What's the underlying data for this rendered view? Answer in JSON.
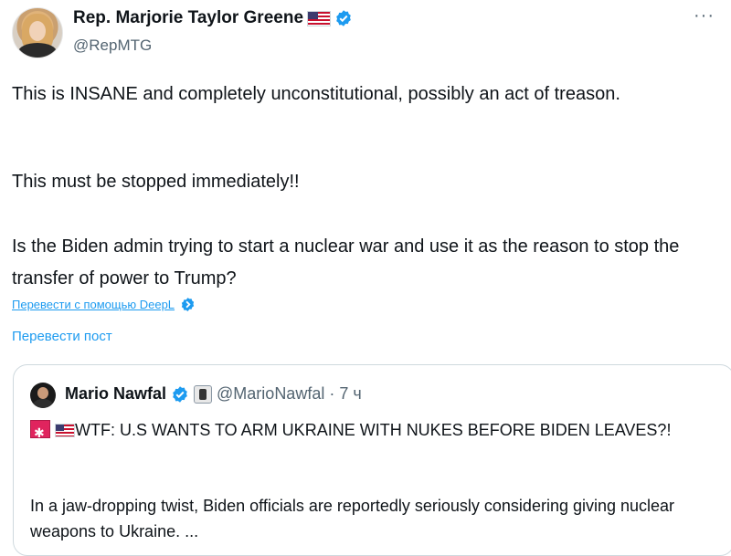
{
  "author": {
    "display_name": "Rep. Marjorie Taylor Greene",
    "handle": "@RepMTG",
    "more_label": "···"
  },
  "body": {
    "paragraph_1": "This is INSANE and completely unconstitutional, possibly an act of treason.",
    "paragraph_2": "This must be stopped immediately!!",
    "paragraph_3": "Is the Biden admin trying to start a nuclear war and use it as the reason to stop the transfer of power to Trump?"
  },
  "translation": {
    "deepl_link": "Перевести с помощью DeepL",
    "translate_post": "Перевести пост"
  },
  "quoted_post": {
    "display_name": "Mario Nawfal",
    "handle": "@MarioNawfal",
    "separator": "·",
    "time": "7 ч",
    "headline": "WTF: U.S WANTS TO ARM UKRAINE WITH NUKES BEFORE BIDEN LEAVES?!",
    "excerpt": "In a jaw-dropping twist,  Biden officials are reportedly seriously considering giving nuclear weapons to Ukraine. ..."
  },
  "colors": {
    "verified_blue": "#1d9bf0",
    "link_blue": "#1d9bf0",
    "secondary_text": "#536471"
  },
  "icons": [
    "us-flag-icon",
    "verified-badge-icon",
    "more-options-icon",
    "deepl-badge-icon",
    "affiliate-badge-icon",
    "alert-emoji-icon"
  ]
}
